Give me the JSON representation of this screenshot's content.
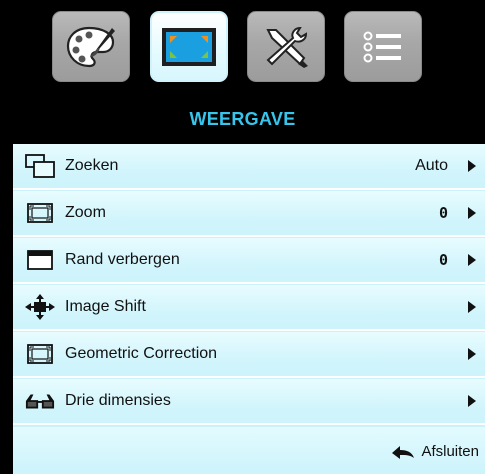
{
  "tabs": [
    {
      "name": "image-tab",
      "icon": "palette-icon"
    },
    {
      "name": "display-tab",
      "icon": "display-frame-icon",
      "active": true
    },
    {
      "name": "setup-tab",
      "icon": "tools-icon"
    },
    {
      "name": "options-tab",
      "icon": "list-options-icon"
    }
  ],
  "header": {
    "title": "WEERGAVE"
  },
  "menu": {
    "items": [
      {
        "label": "Zoeken",
        "value": "Auto",
        "icon": "aspect-ratio-icon"
      },
      {
        "label": "Zoom",
        "value": "0",
        "icon": "zoom-frame-icon"
      },
      {
        "label": "Rand verbergen",
        "value": "0",
        "icon": "edge-mask-icon"
      },
      {
        "label": "Image Shift",
        "value": "",
        "icon": "move-arrows-icon"
      },
      {
        "label": "Geometric Correction",
        "value": "",
        "icon": "geometric-frame-icon"
      },
      {
        "label": "Drie dimensies",
        "value": "",
        "icon": "3d-glasses-icon"
      }
    ]
  },
  "footer": {
    "exit_label": "Afsluiten",
    "icon": "return-arrow-icon"
  },
  "colors": {
    "accent": "#37c5ec",
    "row_bg": "#d2f5fc",
    "header_bg": "#000000"
  }
}
